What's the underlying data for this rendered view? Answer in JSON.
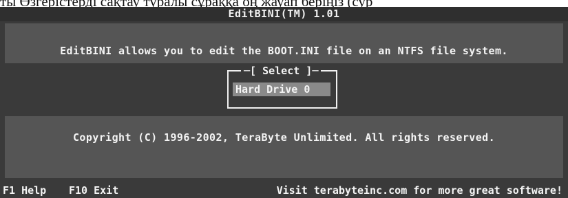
{
  "caption": {
    "partial_text": "ты Өзгерістерді сақтау туралы сұраққа оң жауап беріңіз (сур"
  },
  "window": {
    "title": "EditBINI(TM) 1.01"
  },
  "info": {
    "text": "EditBINI allows you to edit the BOOT.INI file on an NTFS file system."
  },
  "select": {
    "title": "─[ Select ]─",
    "items": [
      "Hard Drive 0"
    ]
  },
  "copyright": {
    "text": "Copyright (C) 1996-2002, TeraByte Unlimited.  All rights reserved."
  },
  "status_bar": {
    "help": "F1 Help",
    "exit": "F10 Exit",
    "visit": "Visit terabyteinc.com for more great software!"
  },
  "colors": {
    "screen_bg": "#3a3a3a",
    "panel_bg": "#555555",
    "highlight_bg": "#8a8a8a",
    "text": "#f2f2f2"
  }
}
